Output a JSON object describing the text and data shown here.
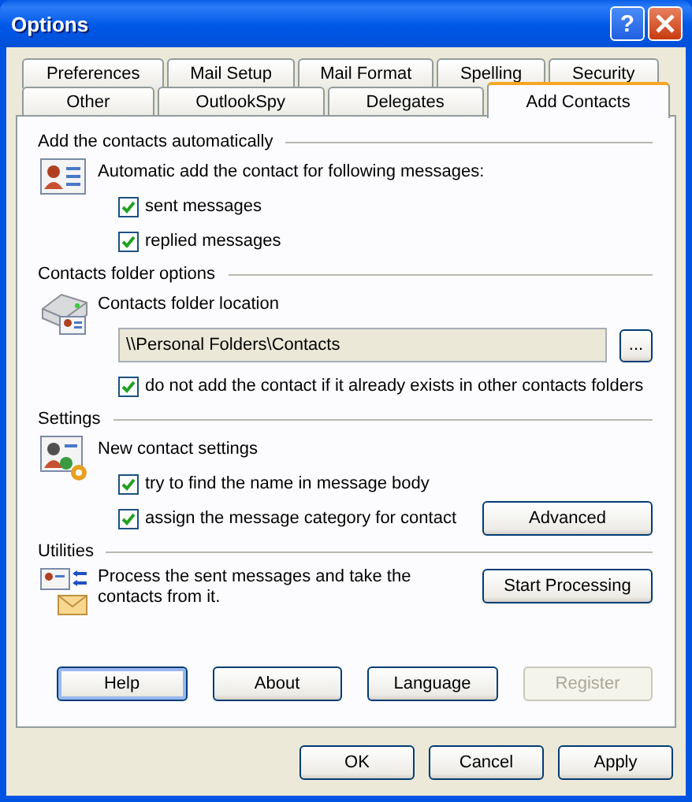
{
  "window": {
    "title": "Options",
    "help_button": "?"
  },
  "tab_rows": [
    [
      {
        "label": "Preferences",
        "selected": false
      },
      {
        "label": "Mail Setup",
        "selected": false
      },
      {
        "label": "Mail Format",
        "selected": false
      },
      {
        "label": "Spelling",
        "selected": false
      },
      {
        "label": "Security",
        "selected": false
      }
    ],
    [
      {
        "label": "Other",
        "selected": false
      },
      {
        "label": "OutlookSpy",
        "selected": false
      },
      {
        "label": "Delegates",
        "selected": false
      },
      {
        "label": "Add Contacts",
        "selected": true
      }
    ]
  ],
  "sections": [
    {
      "heading": "Add the contacts automatically",
      "items": [
        {
          "kind": "label",
          "text": "Automatic add the contact for following messages:"
        },
        {
          "kind": "checkbox",
          "label": "sent messages",
          "checked": true
        },
        {
          "kind": "checkbox",
          "label": "replied messages",
          "checked": true
        }
      ]
    },
    {
      "heading": "Contacts folder options",
      "items": [
        {
          "kind": "label",
          "text": "Contacts folder location"
        },
        {
          "kind": "field",
          "value": "\\\\Personal Folders\\Contacts",
          "button": "..."
        },
        {
          "kind": "checkbox",
          "label": "do not add the contact if it already exists in other contacts folders",
          "checked": true
        }
      ]
    },
    {
      "heading": "Settings",
      "items": [
        {
          "kind": "label",
          "text": "New contact settings"
        },
        {
          "kind": "checkbox",
          "label": "try to find the name in message body",
          "checked": true
        },
        {
          "kind": "checkbox",
          "label": "assign the message category for contact",
          "checked": true,
          "button": "Advanced"
        }
      ]
    },
    {
      "heading": "Utilities",
      "items": [
        {
          "kind": "label",
          "text": "Process the sent messages and take the contacts from it.",
          "button": "Start Processing"
        }
      ]
    }
  ],
  "panel_buttons": [
    {
      "label": "Help",
      "focused": true,
      "disabled": false
    },
    {
      "label": "About",
      "focused": false,
      "disabled": false
    },
    {
      "label": "Language",
      "focused": false,
      "disabled": false
    },
    {
      "label": "Register",
      "focused": false,
      "disabled": true
    }
  ],
  "dialog_buttons": [
    "OK",
    "Cancel",
    "Apply"
  ]
}
